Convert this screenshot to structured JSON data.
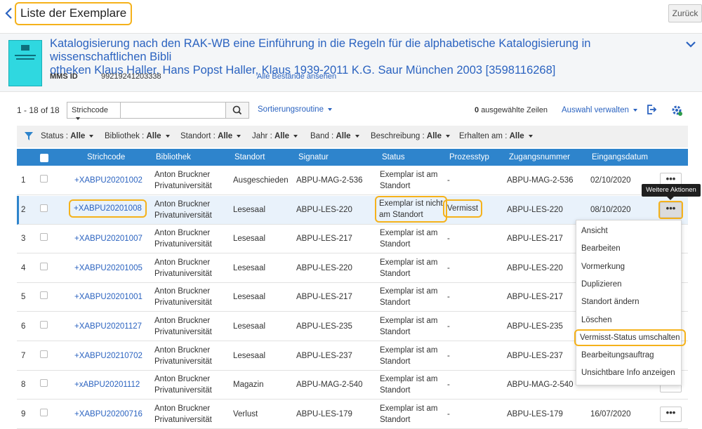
{
  "header": {
    "title": "Liste der Exemplare",
    "back_label": "Zurück"
  },
  "record": {
    "title_line1": "Katalogisierung nach den RAK-WB eine Einführung in die Regeln für die alphabetische Katalogisierung in wissenschaftlichen Bibli",
    "title_line2": "otheken Klaus Haller, Hans Popst Haller, Klaus 1939-2011 K.G. Saur München 2003 [3598116268]",
    "mms_label": "MMS ID",
    "mms_value": "99219241203338",
    "all_holdings": "Alle Bestände ansehen"
  },
  "toolbar": {
    "count": "1 - 18 of 18",
    "search_field": "Strichcode",
    "search_value": "",
    "sort": "Sortierungsroutine",
    "selected_count": "0",
    "selected_text": "ausgewählte Zeilen",
    "manage": "Auswahl verwalten"
  },
  "filters": [
    {
      "label": "Status :",
      "value": "Alle"
    },
    {
      "label": "Bibliothek :",
      "value": "Alle"
    },
    {
      "label": "Standort :",
      "value": "Alle"
    },
    {
      "label": "Jahr :",
      "value": "Alle"
    },
    {
      "label": "Band :",
      "value": "Alle"
    },
    {
      "label": "Beschreibung :",
      "value": "Alle"
    },
    {
      "label": "Erhalten am :",
      "value": "Alle"
    }
  ],
  "columns": [
    "Strichcode",
    "Bibliothek",
    "Standort",
    "Signatur",
    "Status",
    "Prozesstyp",
    "Zugangsnummer",
    "Eingangsdatum"
  ],
  "rows": [
    {
      "n": "1",
      "barcode": "+XABPU20201002",
      "lib1": "Anton Bruckner",
      "lib2": "Privatuniversität",
      "location": "Ausgeschieden",
      "signature": "ABPU-MAG-2-536",
      "status1": "Exemplar ist am",
      "status2": "Standort",
      "process": "-",
      "accession": "ABPU-MAG-2-536",
      "date": "02/10/2020"
    },
    {
      "n": "2",
      "barcode": "+XABPU20201008",
      "lib1": "Anton Bruckner",
      "lib2": "Privatuniversität",
      "location": "Lesesaal",
      "signature": "ABPU-LES-220",
      "status1": "Exemplar ist nicht",
      "status2": "am Standort",
      "process": "Vermisst",
      "accession": "ABPU-LES-220",
      "date": "08/10/2020"
    },
    {
      "n": "3",
      "barcode": "+XABPU20201007",
      "lib1": "Anton Bruckner",
      "lib2": "Privatuniversität",
      "location": "Lesesaal",
      "signature": "ABPU-LES-217",
      "status1": "Exemplar ist am",
      "status2": "Standort",
      "process": "-",
      "accession": "ABPU-LES-217",
      "date": ""
    },
    {
      "n": "4",
      "barcode": "+XABPU20201005",
      "lib1": "Anton Bruckner",
      "lib2": "Privatuniversität",
      "location": "Lesesaal",
      "signature": "ABPU-LES-220",
      "status1": "Exemplar ist am",
      "status2": "Standort",
      "process": "-",
      "accession": "ABPU-LES-220",
      "date": ""
    },
    {
      "n": "5",
      "barcode": "+XABPU20201001",
      "lib1": "Anton Bruckner",
      "lib2": "Privatuniversität",
      "location": "Lesesaal",
      "signature": "ABPU-LES-217",
      "status1": "Exemplar ist am",
      "status2": "Standort",
      "process": "-",
      "accession": "ABPU-LES-217",
      "date": ""
    },
    {
      "n": "6",
      "barcode": "+XABPU20201127",
      "lib1": "Anton Bruckner",
      "lib2": "Privatuniversität",
      "location": "Lesesaal",
      "signature": "ABPU-LES-235",
      "status1": "Exemplar ist am",
      "status2": "Standort",
      "process": "-",
      "accession": "ABPU-LES-235",
      "date": ""
    },
    {
      "n": "7",
      "barcode": "+XABPU20210702",
      "lib1": "Anton Bruckner",
      "lib2": "Privatuniversität",
      "location": "Lesesaal",
      "signature": "ABPU-LES-237",
      "status1": "Exemplar ist am",
      "status2": "Standort",
      "process": "-",
      "accession": "ABPU-LES-237",
      "date": ""
    },
    {
      "n": "8",
      "barcode": "+xABPU20201112",
      "lib1": "Anton Bruckner",
      "lib2": "Privatuniversität",
      "location": "Magazin",
      "signature": "ABPU-MAG-2-540",
      "status1": "Exemplar ist am",
      "status2": "Standort",
      "process": "-",
      "accession": "ABPU-MAG-2-540",
      "date": ""
    },
    {
      "n": "9",
      "barcode": "+XABPU20200716",
      "lib1": "Anton Bruckner",
      "lib2": "Privatuniversität",
      "location": "Verlust",
      "signature": "ABPU-LES-179",
      "status1": "Exemplar ist am",
      "status2": "Standort",
      "process": "-",
      "accession": "ABPU-LES-179",
      "date": "16/07/2020"
    }
  ],
  "more_label": "•••",
  "tooltip": "Weitere Aktionen",
  "menu": [
    "Ansicht",
    "Bearbeiten",
    "Vormerkung",
    "Duplizieren",
    "Standort ändern",
    "Löschen",
    "Vermisst-Status umschalten",
    "Bearbeitungsauftrag",
    "Unsichtbare Info anzeigen"
  ],
  "colors": {
    "accent": "#2e84cc",
    "link": "#2b63c0",
    "highlight": "#f5b21b"
  }
}
